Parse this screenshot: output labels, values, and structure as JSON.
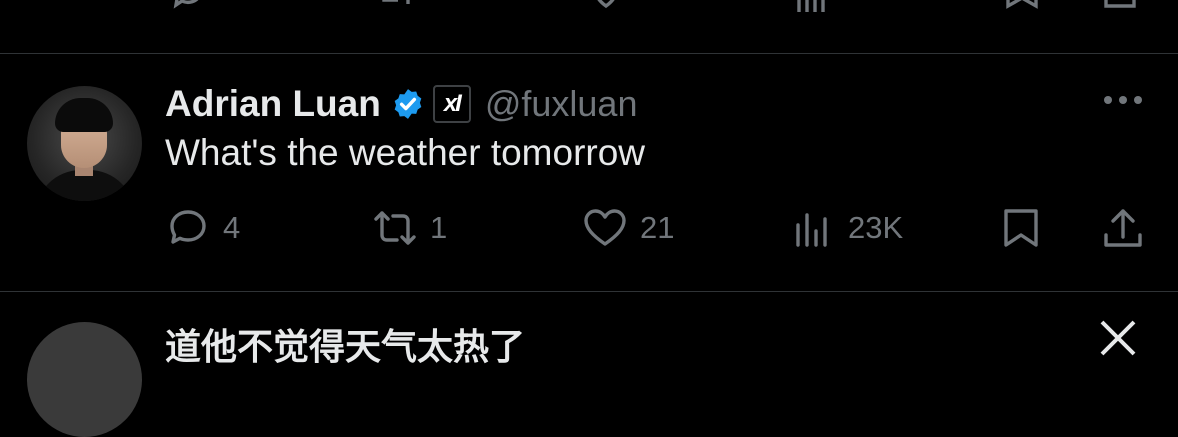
{
  "tweet": {
    "author_name": "Adrian Luan",
    "verified_icon": "verified-badge-icon",
    "affiliation_badge": "xI",
    "handle": "@fuxluan",
    "text": "What's the weather tomorrow",
    "actions": {
      "reply_count": "4",
      "repost_count": "1",
      "like_count": "21",
      "view_count": "23K"
    }
  },
  "next_tweet": {
    "partial_text": "道他不觉得天气太热了"
  },
  "colors": {
    "background": "#000000",
    "primary_text": "#e7e9ea",
    "secondary_text": "#71767b",
    "divider": "#2f3336",
    "verified_blue": "#1d9bf0"
  }
}
